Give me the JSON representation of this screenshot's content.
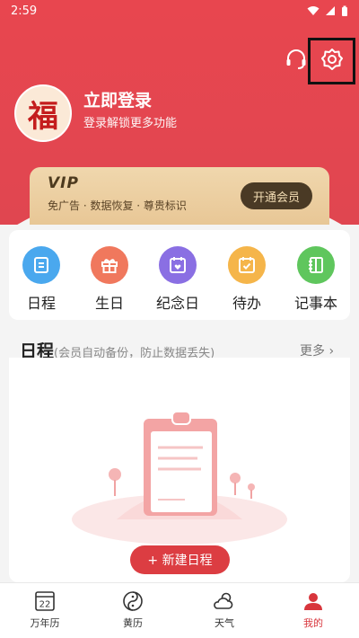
{
  "status_bar": {
    "time": "2:59"
  },
  "profile": {
    "avatar_char": "福",
    "title": "立即登录",
    "subtitle": "登录解锁更多功能"
  },
  "vip": {
    "logo": "VIP",
    "desc": "免广告 · 数据恢复 · 尊贵标识",
    "button": "开通会员"
  },
  "quick_actions": [
    {
      "label": "日程",
      "icon": "schedule-icon",
      "color": "#4aa8ee"
    },
    {
      "label": "生日",
      "icon": "gift-icon",
      "color": "#f0785d"
    },
    {
      "label": "纪念日",
      "icon": "anniversary-icon",
      "color": "#8a6fe3"
    },
    {
      "label": "待办",
      "icon": "todo-icon",
      "color": "#f5b54a"
    },
    {
      "label": "记事本",
      "icon": "notebook-icon",
      "color": "#5fc65d"
    }
  ],
  "schedule_section": {
    "title": "日程",
    "subtitle": "(会员自动备份，防止数据丢失)",
    "more": "更多 ›",
    "add_button": "+ 新建日程"
  },
  "tabs": [
    {
      "label": "万年历",
      "icon": "calendar-icon",
      "icon_text": "22",
      "active": false
    },
    {
      "label": "黄历",
      "icon": "yinyang-icon",
      "active": false
    },
    {
      "label": "天气",
      "icon": "weather-icon",
      "active": false
    },
    {
      "label": "我的",
      "icon": "user-icon",
      "active": true
    }
  ],
  "colors": {
    "primary": "#e04650",
    "active_tab": "#d8353c",
    "vip_gold": "#e8c796"
  }
}
